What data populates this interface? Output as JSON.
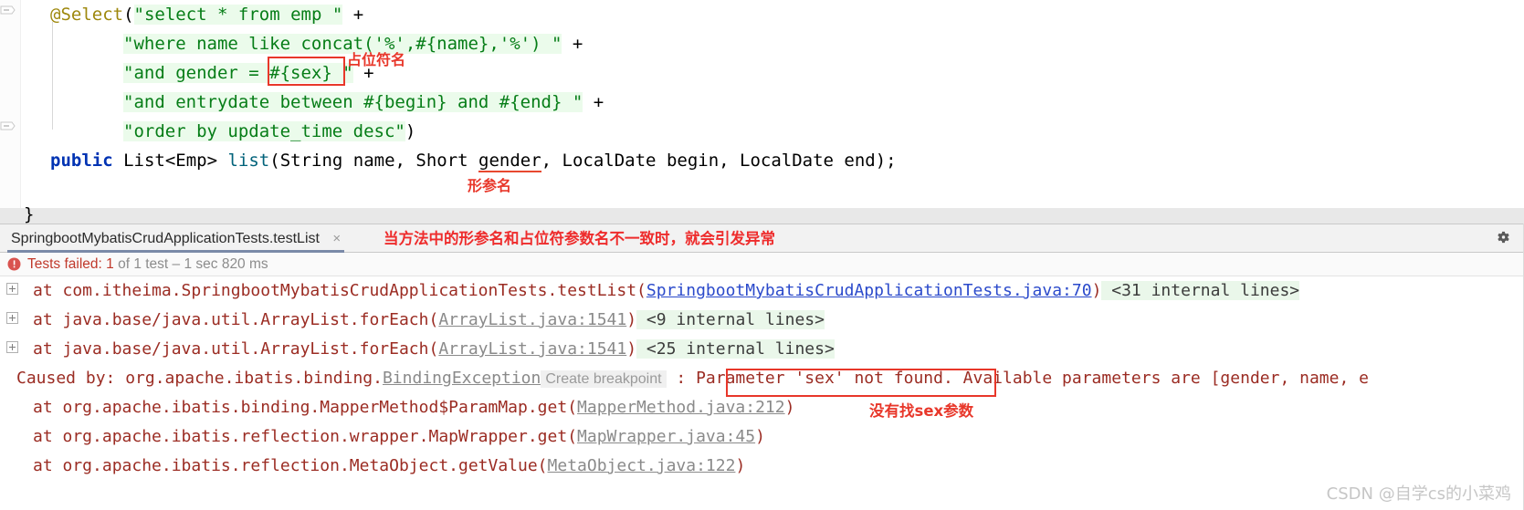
{
  "editor": {
    "code_lines": [
      {
        "indent": 33,
        "segments": [
          {
            "text": "@Select",
            "cls": "ann"
          },
          {
            "text": "(",
            "cls": "plain"
          },
          {
            "text": "\"select * from emp \"",
            "cls": "str strbg"
          },
          {
            "text": " + ",
            "cls": "plain"
          }
        ]
      },
      {
        "indent": 113,
        "segments": [
          {
            "text": "\"where name like concat('%',#{name},'%') \"",
            "cls": "str strbg"
          },
          {
            "text": " + ",
            "cls": "plain"
          }
        ]
      },
      {
        "indent": 113,
        "segments": [
          {
            "text": "\"and gender = #{sex} \"",
            "cls": "str strbg"
          },
          {
            "text": " + ",
            "cls": "plain"
          }
        ]
      },
      {
        "indent": 113,
        "segments": [
          {
            "text": "\"and entrydate between #{begin} and #{end} \"",
            "cls": "str strbg"
          },
          {
            "text": " + ",
            "cls": "plain"
          }
        ]
      },
      {
        "indent": 113,
        "segments": [
          {
            "text": "\"order by update_time desc\"",
            "cls": "str strbg"
          },
          {
            "text": ")",
            "cls": "plain"
          }
        ]
      },
      {
        "indent": 33,
        "segments": [
          {
            "text": "public",
            "cls": "kw"
          },
          {
            "text": " List<Emp> ",
            "cls": "type"
          },
          {
            "text": "list",
            "cls": "method"
          },
          {
            "text": "(String name, Short ",
            "cls": "plain"
          },
          {
            "text": "gender",
            "cls": "plain param-underline"
          },
          {
            "text": ", LocalDate begin, LocalDate end);",
            "cls": "plain"
          }
        ]
      }
    ],
    "closing_brace": "}",
    "annotations": [
      {
        "name": "placeholder-name-label",
        "text": "占位符名"
      },
      {
        "name": "formal-parameter-label",
        "text": "形参名"
      }
    ]
  },
  "panel": {
    "tab_label": "SpringbootMybatisCrudApplicationTests.testList",
    "tab_close_glyph": "×",
    "header_note": "当方法中的形参名和占位符参数名不一致时，就会引发异常",
    "gear_icon": "gear-icon",
    "status": {
      "failed_label": "Tests failed: ",
      "count": "1",
      "detail": " of 1 test – 1 sec 820 ms"
    },
    "trace_rows": [
      {
        "expandable": true,
        "parts": [
          {
            "text": "at com.itheima.SpringbootMybatisCrudApplicationTests.testList(",
            "cls": "excl"
          },
          {
            "text": "SpringbootMybatisCrudApplicationTests.java:70",
            "cls": "lnk"
          },
          {
            "text": ")",
            "cls": "excl"
          },
          {
            "text": " <31 internal lines>",
            "cls": "internal"
          }
        ]
      },
      {
        "expandable": true,
        "parts": [
          {
            "text": "at java.base/java.util.ArrayList.forEach(",
            "cls": "excl"
          },
          {
            "text": "ArrayList.java:1541",
            "cls": "lnkg"
          },
          {
            "text": ")",
            "cls": "excl"
          },
          {
            "text": " <9 internal lines>",
            "cls": "internal"
          }
        ]
      },
      {
        "expandable": true,
        "parts": [
          {
            "text": "at java.base/java.util.ArrayList.forEach(",
            "cls": "excl"
          },
          {
            "text": "ArrayList.java:1541",
            "cls": "lnkg"
          },
          {
            "text": ")",
            "cls": "excl"
          },
          {
            "text": " <25 internal lines>",
            "cls": "internal"
          }
        ]
      },
      {
        "expandable": false,
        "indent_small": true,
        "parts": [
          {
            "text": "Caused by: org.apache.ibatis.binding.",
            "cls": "excl"
          },
          {
            "text": "BindingException",
            "cls": "lnkg"
          },
          {
            "text": "Create breakpoint",
            "cls": "bpchip"
          },
          {
            "text": " : ",
            "cls": "excl"
          },
          {
            "text": "Parameter 'sex' not found",
            "cls": "excl"
          },
          {
            "text": ". Available parameters are [gender, name, e",
            "cls": "excl"
          }
        ]
      },
      {
        "expandable": false,
        "parts": [
          {
            "text": "at org.apache.ibatis.binding.MapperMethod$ParamMap.get(",
            "cls": "excl"
          },
          {
            "text": "MapperMethod.java:212",
            "cls": "lnkg"
          },
          {
            "text": ")",
            "cls": "excl"
          }
        ]
      },
      {
        "expandable": false,
        "parts": [
          {
            "text": "at org.apache.ibatis.reflection.wrapper.MapWrapper.get(",
            "cls": "excl"
          },
          {
            "text": "MapWrapper.java:45",
            "cls": "lnkg"
          },
          {
            "text": ")",
            "cls": "excl"
          }
        ]
      },
      {
        "expandable": false,
        "parts": [
          {
            "text": "at org.apache.ibatis.reflection.MetaObject.getValue(",
            "cls": "excl"
          },
          {
            "text": "MetaObject.java:122",
            "cls": "lnkg"
          },
          {
            "text": ")",
            "cls": "excl"
          }
        ]
      }
    ],
    "trace_annotation": "没有找sex参数"
  },
  "watermark": "CSDN @自学cs的小菜鸡",
  "colors": {
    "annotation_red": "#e8372a",
    "note_red": "#ee2c2c",
    "exception_red": "#9b2c23",
    "link_blue": "#2b4acb",
    "string_green": "#067d17",
    "keyword_blue": "#0033b3",
    "identifier_purple": "#871094",
    "annotation_gold": "#9e880d"
  }
}
